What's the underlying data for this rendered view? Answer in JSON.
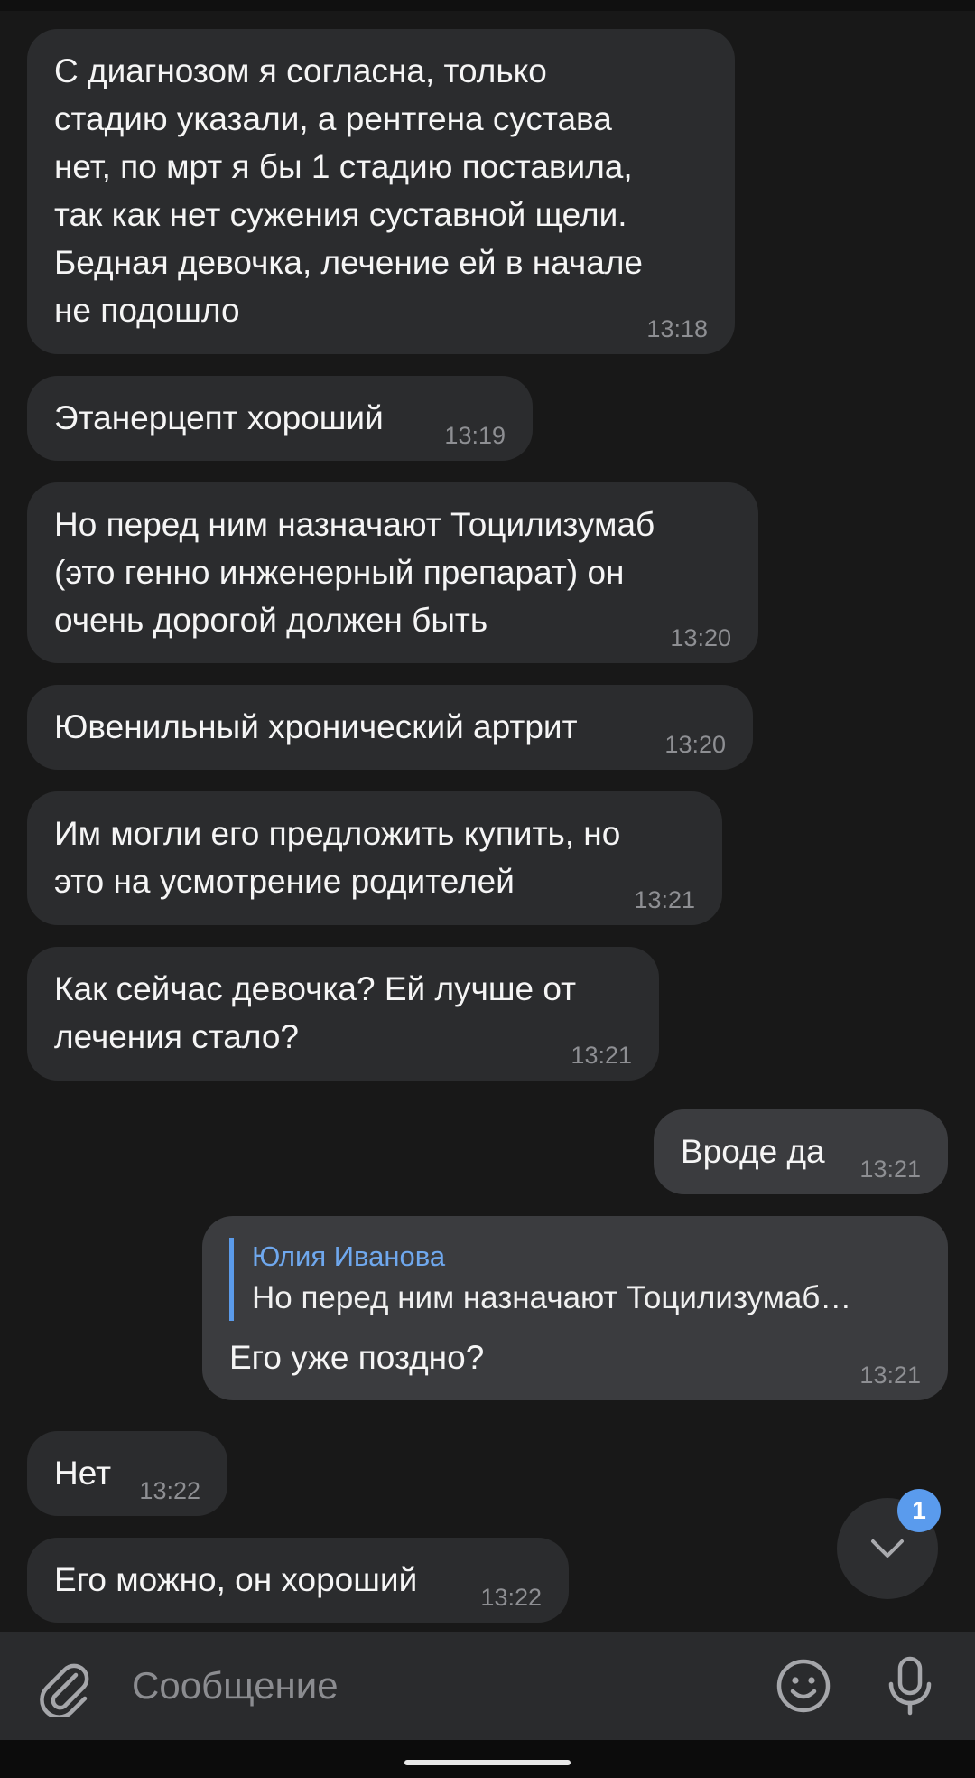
{
  "messages": [
    {
      "text": "С диагнозом я согласна, только\nстадию указали, а рентгена сустава\nнет, по мрт я бы 1 стадию поставила,\nтак как нет сужения суставной щели.\nБедная девочка, лечение ей в начале\nне подошло",
      "time": "13:18"
    },
    {
      "text": "Этанерцепт хороший",
      "time": "13:19"
    },
    {
      "text": "Но перед ним назначают Тоцилизумаб\n(это генно инженерный препарат) он\nочень дорогой должен быть",
      "time": "13:20"
    },
    {
      "text": "Ювенильный хронический артрит",
      "time": "13:20"
    },
    {
      "text": "Им могли его предложить купить, но\nэто на усмотрение родителей",
      "time": "13:21"
    },
    {
      "text": "Как сейчас девочка? Ей лучше от\nлечения стало?",
      "time": "13:21"
    },
    {
      "text": "Вроде да",
      "time": "13:21"
    },
    {
      "text": "Его уже поздно?",
      "time": "13:21",
      "reply_name": "Юлия Иванова",
      "reply_text": "Но перед ним назначают Тоцилизумаб…"
    },
    {
      "text": "Нет",
      "time": "13:22"
    },
    {
      "text": "Его можно, он хороший",
      "time": "13:22"
    }
  ],
  "scroll_down": {
    "badge": "1"
  },
  "composer": {
    "placeholder": "Сообщение"
  },
  "colors": {
    "background": "#181818",
    "incoming_bubble": "#2b2c2e",
    "outgoing_bubble": "#3b3c3f",
    "accent": "#5a9bed"
  },
  "icons": {
    "attach": "paperclip-icon",
    "emoji": "smiley-icon",
    "mic": "microphone-icon",
    "scroll": "chevron-down-icon"
  }
}
